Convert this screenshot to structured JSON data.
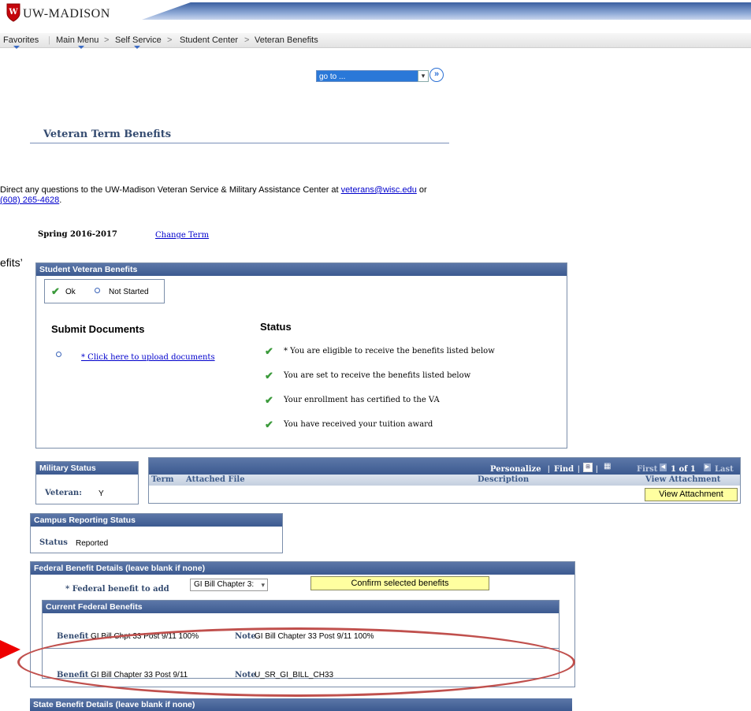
{
  "brand": {
    "name": "UW-MADISON",
    "crest_letter": "W"
  },
  "nav": {
    "items": [
      "Favorites",
      "Main Menu",
      "Self Service",
      "Student Center",
      "Veteran Benefits"
    ],
    "separator": ">"
  },
  "goto": {
    "label": "go to ..."
  },
  "page": {
    "title": "Veteran Term Benefits"
  },
  "contact": {
    "prefix": "Direct any questions to the UW-Madison Veteran Service & Military Assistance Center at",
    "email": "veterans@wisc.edu",
    "or": "or",
    "phone": "(608) 265-4628",
    "period": "."
  },
  "term": {
    "label": "Spring 2016-2017",
    "change": "Change Term"
  },
  "edge_text": "efits’",
  "svb": {
    "header": "Student Veteran Benefits",
    "legend": {
      "ok": "Ok",
      "not_started": "Not Started"
    },
    "submit_title": "Submit Documents",
    "upload_link": "* Click here to upload documents",
    "status_title": "Status",
    "status_items": [
      "* You are eligible to receive the benefits listed below",
      "You are set to receive the benefits listed below",
      "Your enrollment has certified to the VA",
      "You have received your tuition award"
    ]
  },
  "military": {
    "header": "Military Status",
    "label": "Veteran:",
    "value": "Y"
  },
  "attach_grid": {
    "toolbar": {
      "personalize": "Personalize",
      "find": "Find",
      "first": "First",
      "count": "1 of 1",
      "last": "Last"
    },
    "columns": [
      "Term",
      "Attached File",
      "Description",
      "View Attachment"
    ],
    "button": "View Attachment"
  },
  "campus": {
    "header": "Campus Reporting Status",
    "label": "Status",
    "value": "Reported"
  },
  "federal": {
    "header": "Federal Benefit Details (leave blank if none)",
    "add_label": "* Federal benefit to add",
    "select_value": "GI Bill Chapter 3:",
    "confirm": "Confirm selected benefits",
    "current_header": "Current Federal Benefits",
    "rows": [
      {
        "benefit_label": "Benefit",
        "benefit": "GI Bill Chpt 33 Post 9/11 100%",
        "note_label": "Note",
        "note": "GI Bill Chapter 33 Post 9/11 100%"
      },
      {
        "benefit_label": "Benefit",
        "benefit": "GI Bill Chapter 33 Post 9/11",
        "note_label": "Note",
        "note": "U_SR_GI_BILL_CH33"
      }
    ]
  },
  "state": {
    "header": "State Benefit Details (leave blank if none)"
  }
}
